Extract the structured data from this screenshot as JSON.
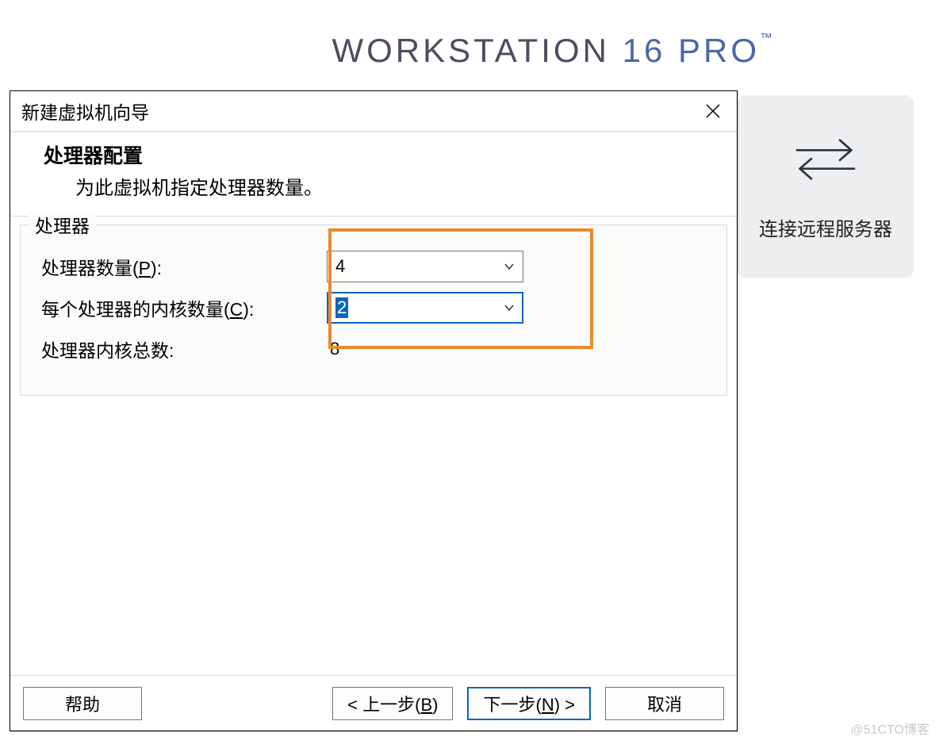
{
  "brand": {
    "name": "WORKSTATION",
    "version": "16",
    "edition": "PRO",
    "tm": "™"
  },
  "sideCard": {
    "label": "连接远程服务器"
  },
  "dialog": {
    "title": "新建虚拟机向导",
    "headerTitle": "处理器配置",
    "headerSub": "为此虚拟机指定处理器数量。",
    "groupLabel": "处理器",
    "processorCount": {
      "label_pre": "处理器数量(",
      "label_hot": "P",
      "label_post": "):",
      "value": "4"
    },
    "coresPerProcessor": {
      "label_pre": "每个处理器的内核数量(",
      "label_hot": "C",
      "label_post": "):",
      "value": "2"
    },
    "totalCores": {
      "label": "处理器内核总数:",
      "value": "8"
    },
    "buttons": {
      "help": "帮助",
      "back_pre": "< 上一步(",
      "back_hot": "B",
      "back_post": ")",
      "next_pre": "下一步(",
      "next_hot": "N",
      "next_post": ") >",
      "cancel": "取消"
    }
  },
  "watermark": "@51CTO博客"
}
